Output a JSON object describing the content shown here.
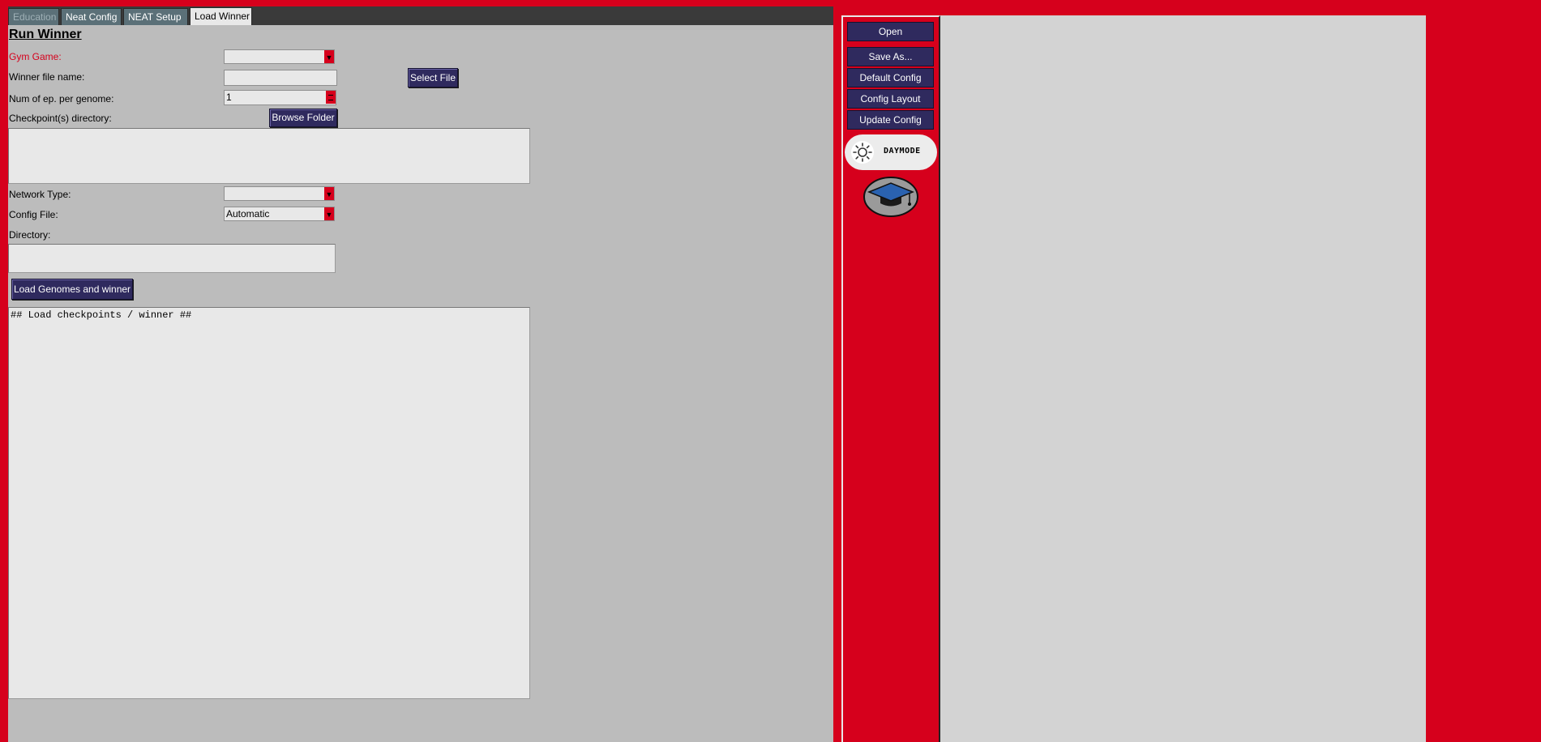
{
  "tabs": [
    {
      "label": "Education",
      "state": "dim"
    },
    {
      "label": "Neat Config",
      "state": "normal"
    },
    {
      "label": "NEAT Setup",
      "state": "normal"
    },
    {
      "label": "Load Winner",
      "state": "active"
    }
  ],
  "run_winner": {
    "heading": "Run Winner",
    "gym_game_label": "Gym Game:",
    "gym_game_value": "",
    "winner_file_label": "Winner file name:",
    "winner_file_value": "",
    "select_file_button": "Select File",
    "num_ep_label": "Num of ep. per genome:",
    "num_ep_value": "1",
    "checkpoint_dir_label": "Checkpoint(s) directory:",
    "browse_folder_button": "Browse Folder",
    "checkpoint_dir_text": "",
    "network_type_label": "Network Type:",
    "network_type_value": "",
    "config_file_label": "Config File:",
    "config_file_value": "Automatic",
    "directory_label": "Directory:",
    "directory_text": "",
    "load_button": "Load Genomes and winner",
    "log_text": "## Load checkpoints / winner ##"
  },
  "sidebar": {
    "buttons": [
      "Open",
      "Save As...",
      "Default Config",
      "Config Layout",
      "Update Config"
    ],
    "daymode_label": "DAYMODE"
  },
  "colors": {
    "accent_red": "#d6001c",
    "button_navy": "#2f2a5e",
    "panel_gray": "#bcbcbc",
    "content_gray": "#d3d3d3"
  }
}
